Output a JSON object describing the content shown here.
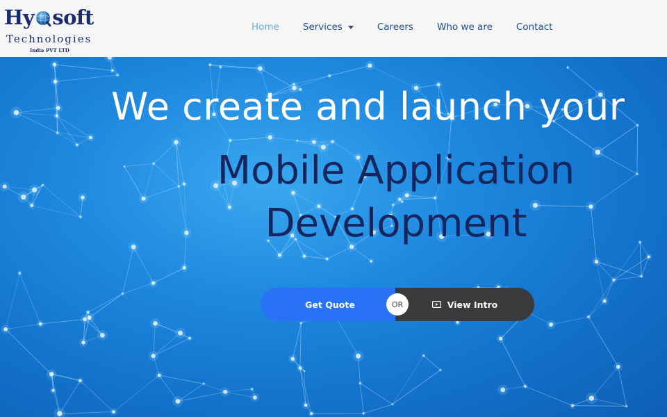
{
  "brand": {
    "logo_left": "Hy",
    "logo_right": "soft",
    "logo_sub": "Technologies",
    "logo_tiny": "India PVT LTD"
  },
  "nav": {
    "items": [
      {
        "label": "Home",
        "active": true
      },
      {
        "label": "Services",
        "has_dropdown": true
      },
      {
        "label": "Careers"
      },
      {
        "label": "Who we are"
      },
      {
        "label": "Contact"
      }
    ]
  },
  "hero": {
    "line1": "We create and launch your",
    "line2": "Mobile Application",
    "line3": "Development",
    "get_quote": "Get Quote",
    "or": "OR",
    "view_intro": "View Intro"
  },
  "colors": {
    "nav_text": "#1f4f8c",
    "nav_active": "#62a9dd",
    "logo": "#1a2c6e",
    "hero_blue": "#1e88df",
    "headline_dark": "#15265e",
    "quote_button": "#2a72f5",
    "intro_button": "#3b3b3d"
  },
  "icons": {
    "globe": "globe-icon",
    "dropdown": "caret-down-icon",
    "play": "play-icon"
  }
}
